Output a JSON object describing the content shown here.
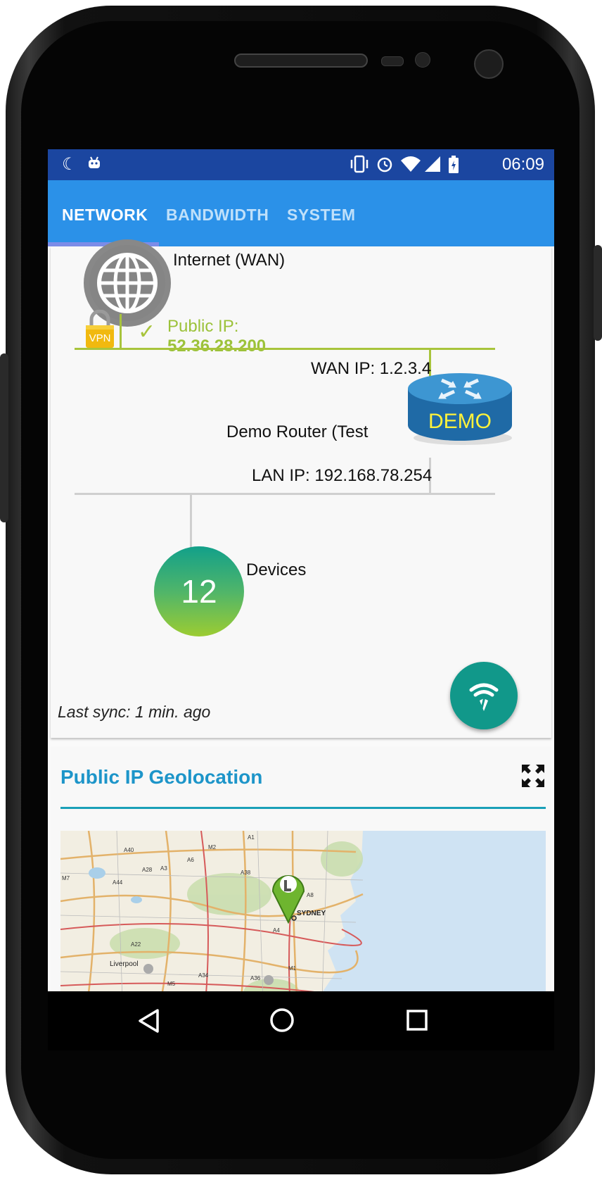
{
  "status_bar": {
    "time": "06:09",
    "left_icons": [
      "moon-icon",
      "android-icon"
    ],
    "right_icons": [
      "vibrate-icon",
      "alarm-icon",
      "wifi-icon",
      "signal-icon",
      "battery-icon"
    ]
  },
  "tabs": [
    {
      "label": "NETWORK",
      "active": true
    },
    {
      "label": "BANDWIDTH",
      "active": false
    },
    {
      "label": "SYSTEM",
      "active": false
    }
  ],
  "network": {
    "internet_label": "Internet (WAN)",
    "vpn_badge": "VPN",
    "public_ip_label": "Public IP:",
    "public_ip_value": "52.36.28.200",
    "wan_ip": "WAN IP: 1.2.3.4",
    "router_name": "Demo Router (Test",
    "router_badge": "DEMO",
    "lan_ip": "LAN IP: 192.168.78.254",
    "device_count": "12",
    "devices_label": "Devices",
    "last_sync": "Last sync: 1 min. ago"
  },
  "geolocation": {
    "title": "Public IP Geolocation",
    "map_labels": {
      "sydney": "SYDNEY",
      "liverpool": "Liverpool",
      "roads": [
        "A40",
        "M2",
        "A1",
        "A28",
        "A6",
        "A3",
        "A8",
        "M7",
        "A44",
        "A38",
        "A4",
        "A22",
        "M1",
        "A34",
        "A36",
        "M5"
      ]
    }
  },
  "colors": {
    "status_bar": "#1b46a0",
    "tab_bar": "#2b91e8",
    "accent_green": "#9cc23a",
    "fab": "#11988a",
    "geo_title": "#1d95c9"
  }
}
